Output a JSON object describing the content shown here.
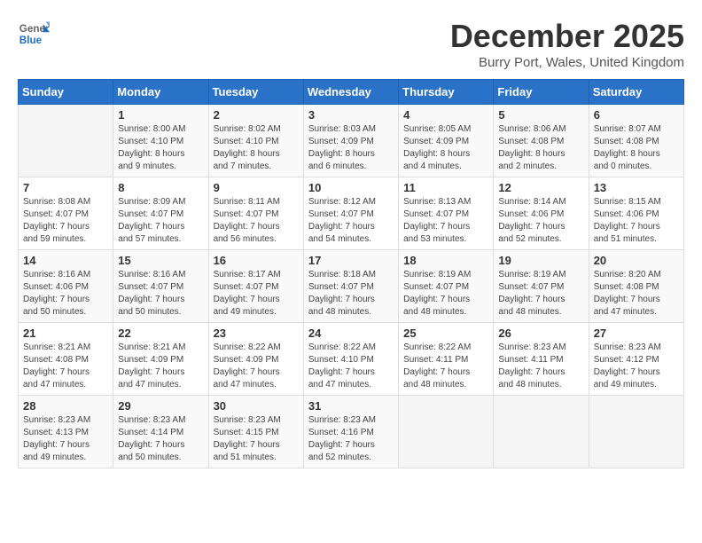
{
  "header": {
    "logo_general": "General",
    "logo_blue": "Blue",
    "month_title": "December 2025",
    "location": "Burry Port, Wales, United Kingdom"
  },
  "days_of_week": [
    "Sunday",
    "Monday",
    "Tuesday",
    "Wednesday",
    "Thursday",
    "Friday",
    "Saturday"
  ],
  "weeks": [
    [
      {
        "day": "",
        "info": ""
      },
      {
        "day": "1",
        "info": "Sunrise: 8:00 AM\nSunset: 4:10 PM\nDaylight: 8 hours\nand 9 minutes."
      },
      {
        "day": "2",
        "info": "Sunrise: 8:02 AM\nSunset: 4:10 PM\nDaylight: 8 hours\nand 7 minutes."
      },
      {
        "day": "3",
        "info": "Sunrise: 8:03 AM\nSunset: 4:09 PM\nDaylight: 8 hours\nand 6 minutes."
      },
      {
        "day": "4",
        "info": "Sunrise: 8:05 AM\nSunset: 4:09 PM\nDaylight: 8 hours\nand 4 minutes."
      },
      {
        "day": "5",
        "info": "Sunrise: 8:06 AM\nSunset: 4:08 PM\nDaylight: 8 hours\nand 2 minutes."
      },
      {
        "day": "6",
        "info": "Sunrise: 8:07 AM\nSunset: 4:08 PM\nDaylight: 8 hours\nand 0 minutes."
      }
    ],
    [
      {
        "day": "7",
        "info": "Sunrise: 8:08 AM\nSunset: 4:07 PM\nDaylight: 7 hours\nand 59 minutes."
      },
      {
        "day": "8",
        "info": "Sunrise: 8:09 AM\nSunset: 4:07 PM\nDaylight: 7 hours\nand 57 minutes."
      },
      {
        "day": "9",
        "info": "Sunrise: 8:11 AM\nSunset: 4:07 PM\nDaylight: 7 hours\nand 56 minutes."
      },
      {
        "day": "10",
        "info": "Sunrise: 8:12 AM\nSunset: 4:07 PM\nDaylight: 7 hours\nand 54 minutes."
      },
      {
        "day": "11",
        "info": "Sunrise: 8:13 AM\nSunset: 4:07 PM\nDaylight: 7 hours\nand 53 minutes."
      },
      {
        "day": "12",
        "info": "Sunrise: 8:14 AM\nSunset: 4:06 PM\nDaylight: 7 hours\nand 52 minutes."
      },
      {
        "day": "13",
        "info": "Sunrise: 8:15 AM\nSunset: 4:06 PM\nDaylight: 7 hours\nand 51 minutes."
      }
    ],
    [
      {
        "day": "14",
        "info": "Sunrise: 8:16 AM\nSunset: 4:06 PM\nDaylight: 7 hours\nand 50 minutes."
      },
      {
        "day": "15",
        "info": "Sunrise: 8:16 AM\nSunset: 4:07 PM\nDaylight: 7 hours\nand 50 minutes."
      },
      {
        "day": "16",
        "info": "Sunrise: 8:17 AM\nSunset: 4:07 PM\nDaylight: 7 hours\nand 49 minutes."
      },
      {
        "day": "17",
        "info": "Sunrise: 8:18 AM\nSunset: 4:07 PM\nDaylight: 7 hours\nand 48 minutes."
      },
      {
        "day": "18",
        "info": "Sunrise: 8:19 AM\nSunset: 4:07 PM\nDaylight: 7 hours\nand 48 minutes."
      },
      {
        "day": "19",
        "info": "Sunrise: 8:19 AM\nSunset: 4:07 PM\nDaylight: 7 hours\nand 48 minutes."
      },
      {
        "day": "20",
        "info": "Sunrise: 8:20 AM\nSunset: 4:08 PM\nDaylight: 7 hours\nand 47 minutes."
      }
    ],
    [
      {
        "day": "21",
        "info": "Sunrise: 8:21 AM\nSunset: 4:08 PM\nDaylight: 7 hours\nand 47 minutes."
      },
      {
        "day": "22",
        "info": "Sunrise: 8:21 AM\nSunset: 4:09 PM\nDaylight: 7 hours\nand 47 minutes."
      },
      {
        "day": "23",
        "info": "Sunrise: 8:22 AM\nSunset: 4:09 PM\nDaylight: 7 hours\nand 47 minutes."
      },
      {
        "day": "24",
        "info": "Sunrise: 8:22 AM\nSunset: 4:10 PM\nDaylight: 7 hours\nand 47 minutes."
      },
      {
        "day": "25",
        "info": "Sunrise: 8:22 AM\nSunset: 4:11 PM\nDaylight: 7 hours\nand 48 minutes."
      },
      {
        "day": "26",
        "info": "Sunrise: 8:23 AM\nSunset: 4:11 PM\nDaylight: 7 hours\nand 48 minutes."
      },
      {
        "day": "27",
        "info": "Sunrise: 8:23 AM\nSunset: 4:12 PM\nDaylight: 7 hours\nand 49 minutes."
      }
    ],
    [
      {
        "day": "28",
        "info": "Sunrise: 8:23 AM\nSunset: 4:13 PM\nDaylight: 7 hours\nand 49 minutes."
      },
      {
        "day": "29",
        "info": "Sunrise: 8:23 AM\nSunset: 4:14 PM\nDaylight: 7 hours\nand 50 minutes."
      },
      {
        "day": "30",
        "info": "Sunrise: 8:23 AM\nSunset: 4:15 PM\nDaylight: 7 hours\nand 51 minutes."
      },
      {
        "day": "31",
        "info": "Sunrise: 8:23 AM\nSunset: 4:16 PM\nDaylight: 7 hours\nand 52 minutes."
      },
      {
        "day": "",
        "info": ""
      },
      {
        "day": "",
        "info": ""
      },
      {
        "day": "",
        "info": ""
      }
    ]
  ]
}
